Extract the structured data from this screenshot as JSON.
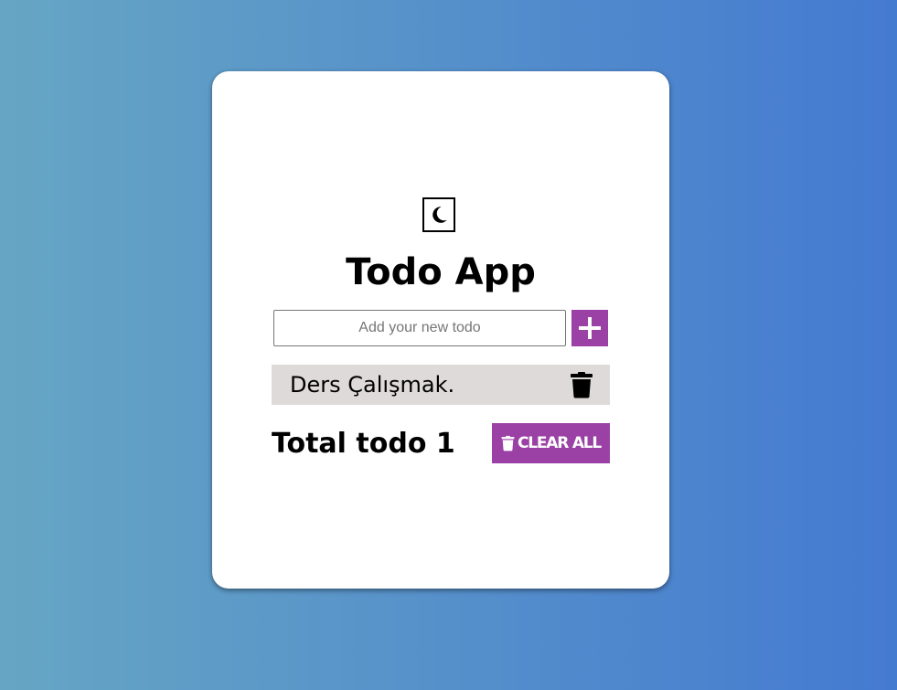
{
  "colors": {
    "accent": "#9b41a6",
    "todo_item_bg": "#dedad9",
    "card_bg": "#ffffff",
    "gradient_start": "#66a6c4",
    "gradient_end": "#457ad1"
  },
  "header": {
    "theme_toggle_icon": "moon-icon",
    "title": "Todo App"
  },
  "input": {
    "placeholder": "Add your new todo",
    "value": "",
    "add_icon": "plus-icon"
  },
  "todos": [
    {
      "text": "Ders Çalışmak.",
      "delete_icon": "trash-icon"
    }
  ],
  "footer": {
    "total_label": "Total todo 1",
    "clear_all_label": "CLEAR ALL",
    "clear_all_icon": "trash-icon"
  }
}
